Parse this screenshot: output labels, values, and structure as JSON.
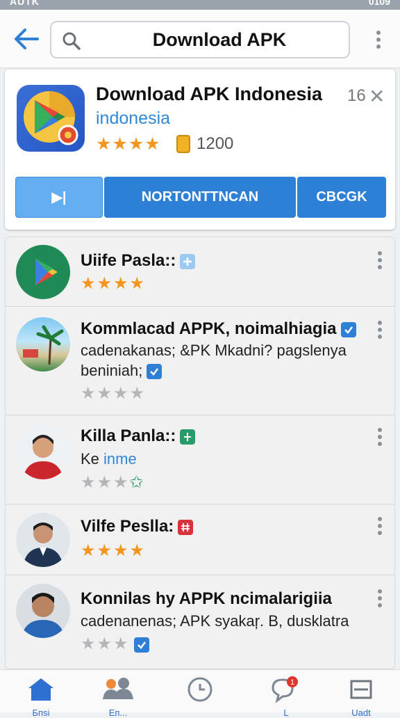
{
  "status_bar": {
    "left": "AUTK",
    "right": "0109"
  },
  "search": {
    "query": "Download APK"
  },
  "app": {
    "title": "Download APK Indonesia",
    "subtitle": "indonesia",
    "stars": "★★★★",
    "rating_count": "1200",
    "badge_number": "16",
    "close": "✕",
    "buttons": {
      "play": "▶|",
      "middle": "NORTONTTNCAN",
      "right": "CBCGK"
    }
  },
  "list": [
    {
      "name": "Uiife Pasla::",
      "stars": "★★★★",
      "rating": 4,
      "badge": "light"
    },
    {
      "name": "Kommlacad APPK, noimalhiagia",
      "desc1": "cadenakanas; &PK Mkadni? pagslenya",
      "desc2": "beniniah;",
      "stars": "★★★★",
      "rating": 0,
      "badge": "blue"
    },
    {
      "name": "Killa Panla::",
      "desc_prefix": "Ke",
      "desc_blue": "inme",
      "stars": "★★★",
      "rating": 0,
      "badge": "green"
    },
    {
      "name": "Vilfe Peslla:",
      "stars": "★★★★",
      "rating": 4,
      "badge": "red"
    },
    {
      "name": "Konnilas hy APPK ncimalarigiia",
      "desc1": "cadenanenas; APK syakaŗ. B, dusklatra",
      "stars": "★★★",
      "rating": 0,
      "badge": "blue"
    }
  ],
  "colors": {
    "accent": "#2e7fd6",
    "star": "#f3951e",
    "link": "#2f87d8"
  },
  "nav": [
    {
      "icon": "home-icon",
      "label": "Бпѕі"
    },
    {
      "icon": "friends-icon",
      "label": "Еп..."
    },
    {
      "icon": "clock-icon",
      "label": ""
    },
    {
      "icon": "chat-icon",
      "label": "L"
    },
    {
      "icon": "window-icon",
      "label": "Uadt"
    }
  ]
}
